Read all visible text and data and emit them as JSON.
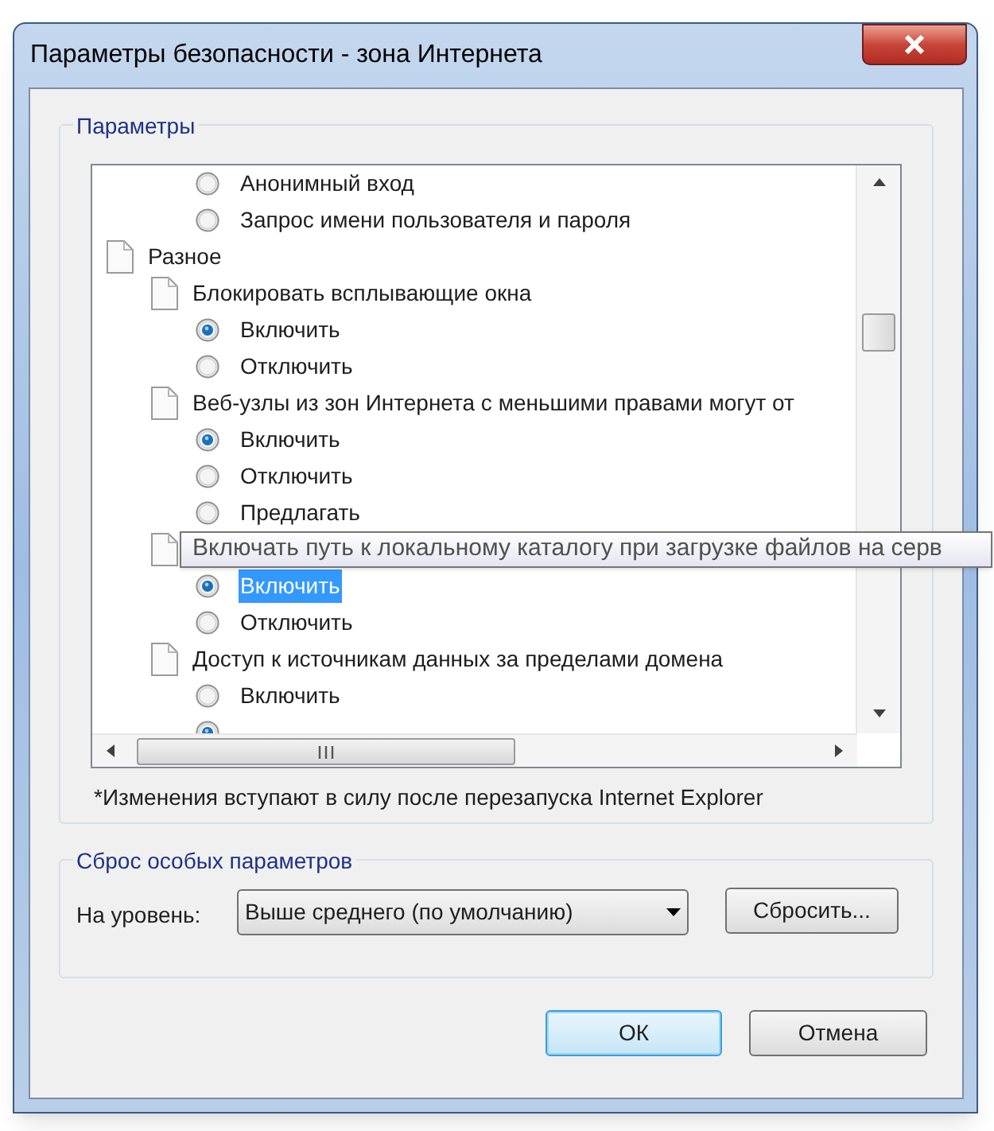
{
  "window": {
    "title": "Параметры безопасности - зона Интернета"
  },
  "settings_group": {
    "legend": "Параметры",
    "tree": [
      {
        "kind": "continued",
        "children": [
          {
            "kind": "continued",
            "children": [
              {
                "kind": "radio",
                "label": "Анонимный вход",
                "selected": false,
                "focused": false
              },
              {
                "kind": "radio",
                "label": "Запрос имени пользователя и пароля",
                "selected": false,
                "focused": false
              }
            ]
          }
        ]
      },
      {
        "kind": "setting",
        "label": "Разное",
        "children": [
          {
            "kind": "setting",
            "label": "Блокировать всплывающие окна",
            "children": [
              {
                "kind": "radio",
                "label": "Включить",
                "selected": true,
                "focused": false
              },
              {
                "kind": "radio",
                "label": "Отключить",
                "selected": false,
                "focused": false
              }
            ]
          },
          {
            "kind": "setting",
            "label": "Веб-узлы из зон Интернета с меньшими правами могут от",
            "children": [
              {
                "kind": "radio",
                "label": "Включить",
                "selected": true,
                "focused": false
              },
              {
                "kind": "radio",
                "label": "Отключить",
                "selected": false,
                "focused": false
              },
              {
                "kind": "radio",
                "label": "Предлагать",
                "selected": false,
                "focused": false
              }
            ]
          },
          {
            "kind": "setting",
            "children": [
              {
                "kind": "radio",
                "label": "Включить",
                "selected": true,
                "focused": true
              },
              {
                "kind": "radio",
                "label": "Отключить",
                "selected": false,
                "focused": false
              }
            ]
          },
          {
            "kind": "setting",
            "label": "Доступ к источникам данных за пределами домена",
            "children": [
              {
                "kind": "radio",
                "label": "Включить",
                "selected": false,
                "focused": false
              },
              {
                "kind": "radio",
                "selected": true,
                "focused": false
              }
            ]
          }
        ]
      }
    ],
    "note": "*Изменения вступают в силу после перезапуска Internet Explorer"
  },
  "tooltip": {
    "text": "Включать путь к локальному каталогу при загрузке файлов на серв"
  },
  "reset_group": {
    "legend": "Сброс особых параметров",
    "level_label": "На уровень:",
    "level_dropdown": {
      "value": "Выше среднего (по умолчанию)"
    },
    "reset_button": "Сбросить..."
  },
  "buttons": [
    {
      "label": "ОК",
      "default": true
    },
    {
      "label": "Отмена",
      "default": false
    }
  ]
}
